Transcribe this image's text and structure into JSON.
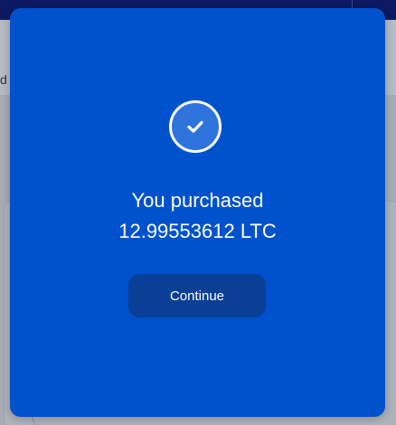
{
  "background": {
    "header_text": "d"
  },
  "modal": {
    "icon": "check-circle-icon",
    "message_line1": "You purchased",
    "message_line2": "12.99553612 LTC",
    "continue_label": "Continue",
    "accent_color": "#0052cc"
  }
}
